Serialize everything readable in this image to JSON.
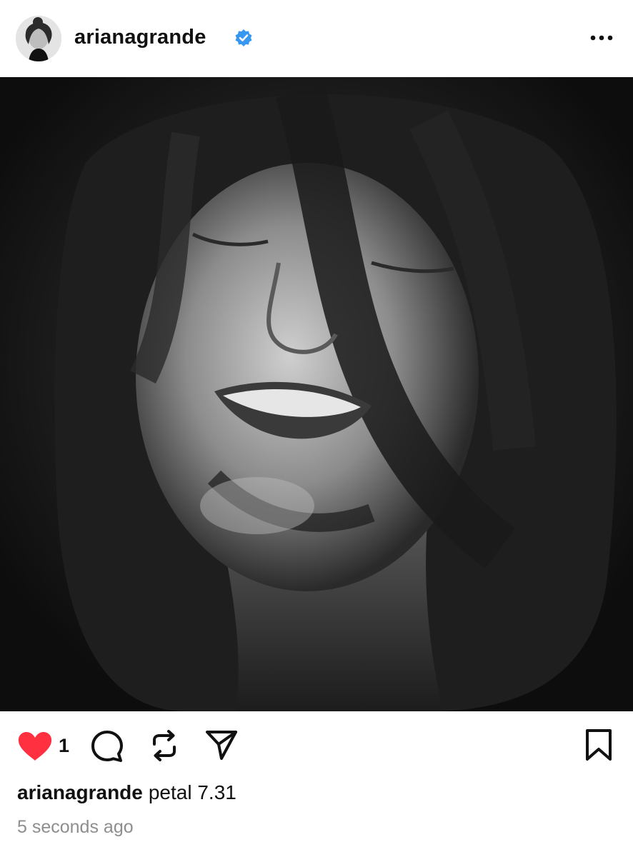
{
  "post": {
    "username": "arianagrande",
    "verified": true,
    "like_count": "1",
    "caption_text": "petal 7.31",
    "timestamp": "5 seconds ago"
  },
  "icons": {
    "avatar": "profile-avatar",
    "verified": "verified-badge-icon",
    "more": "more-options-icon",
    "like": "heart-icon",
    "comment": "comment-icon",
    "repost": "repost-icon",
    "share": "send-icon",
    "save": "bookmark-icon"
  },
  "colors": {
    "like_red": "#ff3040",
    "verified_blue": "#3897f0",
    "timestamp_gray": "#8e8e8e"
  }
}
